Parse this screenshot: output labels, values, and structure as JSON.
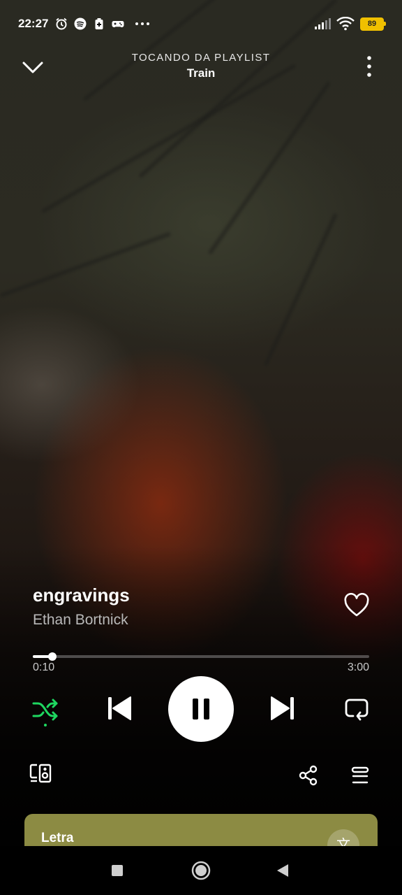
{
  "status_bar": {
    "time": "22:27",
    "battery_level": "89",
    "left_icons": [
      "alarm-icon",
      "spotify-icon",
      "battery-saver-icon",
      "gamepad-icon",
      "more-notifications-icon"
    ],
    "right_icons": [
      "signal-icon",
      "wifi-icon",
      "battery-icon"
    ]
  },
  "header": {
    "context_label": "TOCANDO DA PLAYLIST",
    "context_name": "Train"
  },
  "track": {
    "title": "engravings",
    "artist": "Ethan Bortnick",
    "liked": false
  },
  "progress": {
    "elapsed": "0:10",
    "total": "3:00",
    "fraction": 0.058
  },
  "controls": {
    "shuffle_active": true,
    "is_playing": true,
    "accent_color": "#1ed760"
  },
  "lyrics": {
    "title": "Letra",
    "translate_glyph": "文",
    "card_color": "#8c8b43"
  },
  "nav": {
    "buttons": [
      "recents-square-icon",
      "home-circle-icon",
      "back-triangle-icon"
    ]
  }
}
